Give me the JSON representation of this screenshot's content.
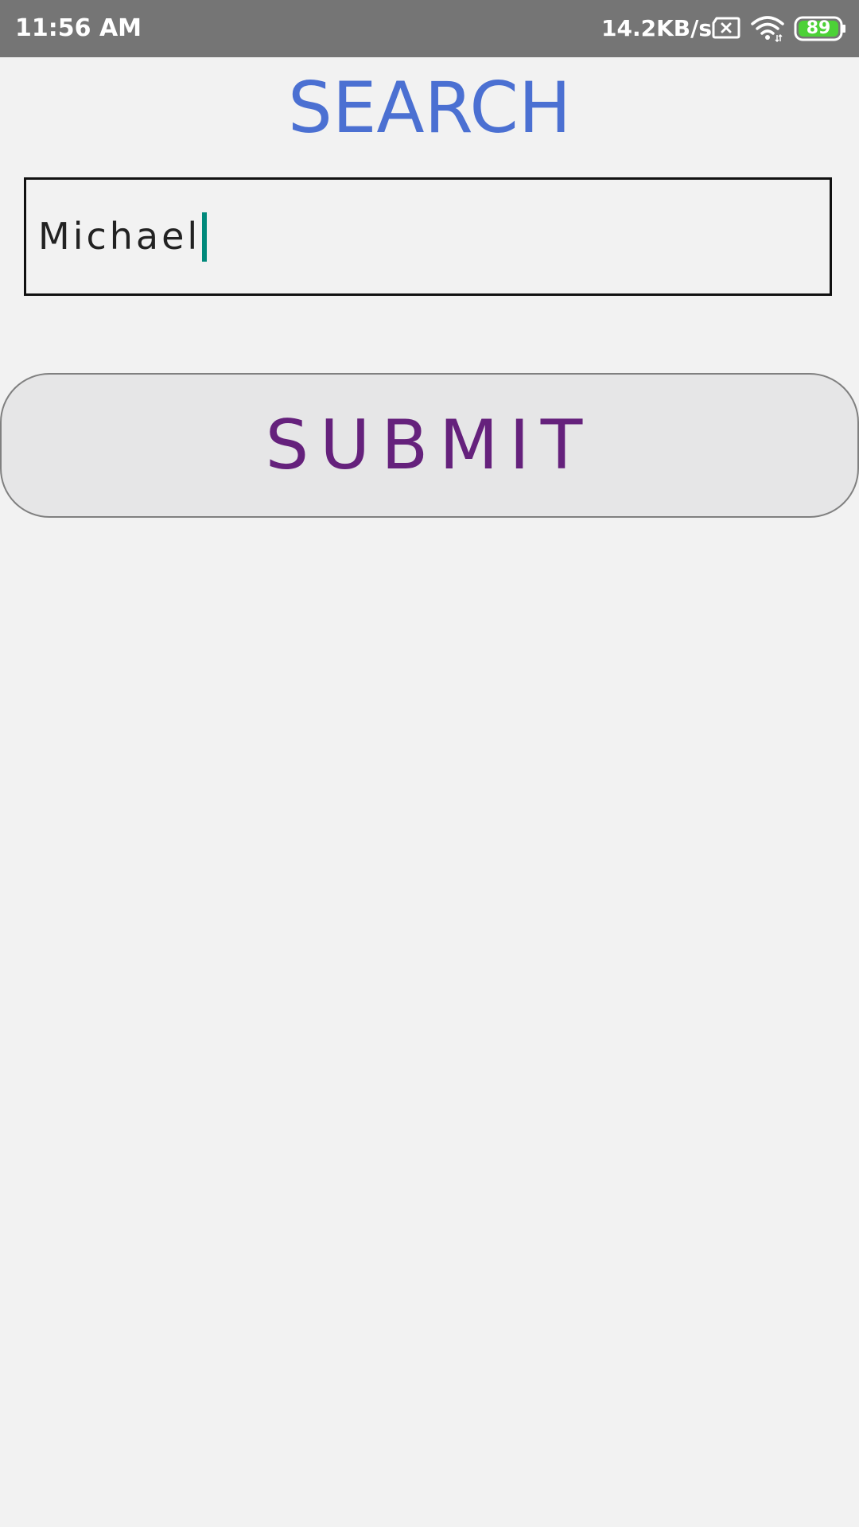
{
  "status_bar": {
    "time": "11:56 AM",
    "network_speed": "14.2KB/s",
    "sim_icon": "sim-error-icon",
    "wifi_icon": "wifi-icon",
    "battery_level": "89",
    "battery_color": "#4cd137"
  },
  "page": {
    "title": "SEARCH",
    "title_color": "#4b70d2",
    "background": "#f2f2f2"
  },
  "search": {
    "value": "Michael",
    "caret_color": "#00897b"
  },
  "submit": {
    "label": "SUBMIT",
    "text_color": "#65217c"
  }
}
